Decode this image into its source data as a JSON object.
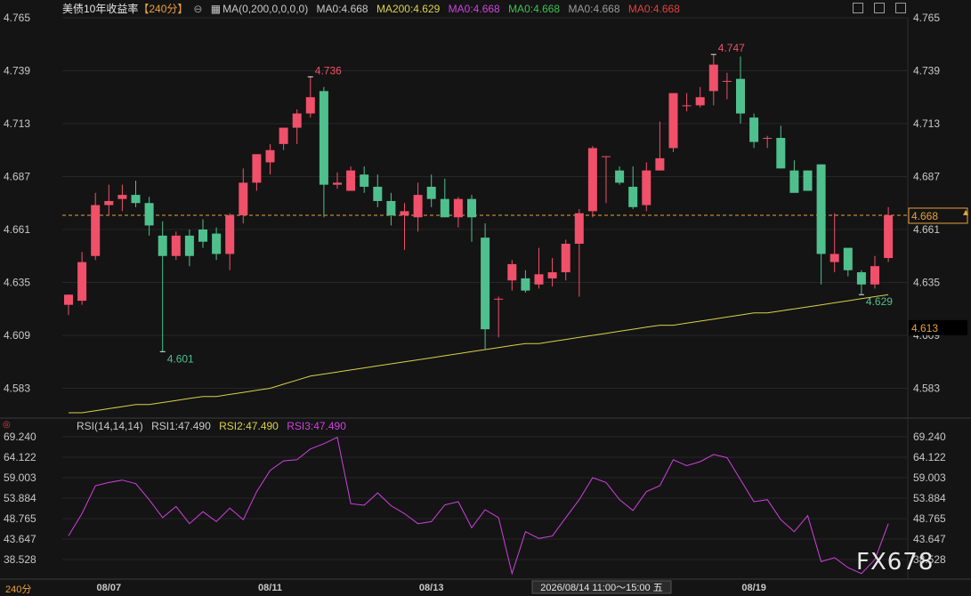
{
  "header": {
    "symbol": "美债10年收益率",
    "period": "【240分】",
    "indicator_name": "MA(0,200,0,0,0,0)",
    "ma0_a": "MA0:4.668",
    "ma200": "MA200:4.629",
    "ma0_b": "MA0:4.668",
    "ma0_c": "MA0:4.668",
    "ma0_d": "MA0:4.668",
    "ma0_e": "MA0:4.668"
  },
  "rsi_header": {
    "name": "RSI(14,14,14)",
    "rsi1": "RSI1:47.490",
    "rsi2": "RSI2:47.490",
    "rsi3": "RSI3:47.490"
  },
  "timeframe_label": "240分",
  "crosshair_time": "2026/08/14 11:00～15:00 五",
  "watermark": "FX678",
  "colors": {
    "up": "#f0506a",
    "down": "#4fc08d",
    "ma200": "#d9d14a",
    "rsi": "#d040e0",
    "last_line": "#e8a040",
    "bg": "#141414"
  },
  "chart_data": [
    {
      "type": "candlestick",
      "title": "美债10年收益率",
      "ylim": [
        4.57,
        4.765
      ],
      "y_ticks": [
        "4.765",
        "4.739",
        "4.713",
        "4.687",
        "4.661",
        "4.635",
        "4.609",
        "4.583"
      ],
      "x_labels": [
        {
          "index": 3,
          "label": "08/07"
        },
        {
          "index": 15,
          "label": "08/11"
        },
        {
          "index": 27,
          "label": "08/13"
        },
        {
          "index": 51,
          "label": "08/19"
        }
      ],
      "candles": [
        {
          "o": 4.624,
          "h": 4.629,
          "l": 4.619,
          "c": 4.629
        },
        {
          "o": 4.626,
          "h": 4.65,
          "l": 4.624,
          "c": 4.645
        },
        {
          "o": 4.648,
          "h": 4.679,
          "l": 4.646,
          "c": 4.673
        },
        {
          "o": 4.673,
          "h": 4.683,
          "l": 4.668,
          "c": 4.675
        },
        {
          "o": 4.676,
          "h": 4.683,
          "l": 4.67,
          "c": 4.678
        },
        {
          "o": 4.678,
          "h": 4.685,
          "l": 4.672,
          "c": 4.674
        },
        {
          "o": 4.674,
          "h": 4.677,
          "l": 4.658,
          "c": 4.663
        },
        {
          "o": 4.658,
          "h": 4.665,
          "l": 4.601,
          "c": 4.648
        },
        {
          "o": 4.648,
          "h": 4.66,
          "l": 4.646,
          "c": 4.658
        },
        {
          "o": 4.658,
          "h": 4.661,
          "l": 4.643,
          "c": 4.648
        },
        {
          "o": 4.661,
          "h": 4.666,
          "l": 4.652,
          "c": 4.655
        },
        {
          "o": 4.659,
          "h": 4.662,
          "l": 4.646,
          "c": 4.649
        },
        {
          "o": 4.649,
          "h": 4.669,
          "l": 4.641,
          "c": 4.668
        },
        {
          "o": 4.668,
          "h": 4.691,
          "l": 4.664,
          "c": 4.684
        },
        {
          "o": 4.684,
          "h": 4.698,
          "l": 4.68,
          "c": 4.698
        },
        {
          "o": 4.694,
          "h": 4.703,
          "l": 4.688,
          "c": 4.7
        },
        {
          "o": 4.703,
          "h": 4.711,
          "l": 4.7,
          "c": 4.711
        },
        {
          "o": 4.711,
          "h": 4.72,
          "l": 4.703,
          "c": 4.718
        },
        {
          "o": 4.718,
          "h": 4.736,
          "l": 4.716,
          "c": 4.726
        },
        {
          "o": 4.729,
          "h": 4.731,
          "l": 4.667,
          "c": 4.683
        },
        {
          "o": 4.683,
          "h": 4.689,
          "l": 4.681,
          "c": 4.684
        },
        {
          "o": 4.68,
          "h": 4.692,
          "l": 4.68,
          "c": 4.69
        },
        {
          "o": 4.688,
          "h": 4.692,
          "l": 4.679,
          "c": 4.682
        },
        {
          "o": 4.682,
          "h": 4.688,
          "l": 4.672,
          "c": 4.675
        },
        {
          "o": 4.675,
          "h": 4.679,
          "l": 4.663,
          "c": 4.668
        },
        {
          "o": 4.668,
          "h": 4.674,
          "l": 4.651,
          "c": 4.67
        },
        {
          "o": 4.667,
          "h": 4.684,
          "l": 4.66,
          "c": 4.678
        },
        {
          "o": 4.682,
          "h": 4.688,
          "l": 4.672,
          "c": 4.676
        },
        {
          "o": 4.676,
          "h": 4.686,
          "l": 4.667,
          "c": 4.667
        },
        {
          "o": 4.667,
          "h": 4.677,
          "l": 4.662,
          "c": 4.676
        },
        {
          "o": 4.676,
          "h": 4.678,
          "l": 4.655,
          "c": 4.667
        },
        {
          "o": 4.657,
          "h": 4.664,
          "l": 4.602,
          "c": 4.612
        },
        {
          "o": 4.627,
          "h": 4.628,
          "l": 4.608,
          "c": 4.627
        },
        {
          "o": 4.636,
          "h": 4.646,
          "l": 4.631,
          "c": 4.644
        },
        {
          "o": 4.637,
          "h": 4.641,
          "l": 4.63,
          "c": 4.631
        },
        {
          "o": 4.634,
          "h": 4.652,
          "l": 4.632,
          "c": 4.639
        },
        {
          "o": 4.637,
          "h": 4.647,
          "l": 4.633,
          "c": 4.64
        },
        {
          "o": 4.64,
          "h": 4.656,
          "l": 4.636,
          "c": 4.654
        },
        {
          "o": 4.654,
          "h": 4.671,
          "l": 4.628,
          "c": 4.669
        },
        {
          "o": 4.67,
          "h": 4.702,
          "l": 4.667,
          "c": 4.701
        },
        {
          "o": 4.697,
          "h": 4.697,
          "l": 4.674,
          "c": 4.697
        },
        {
          "o": 4.69,
          "h": 4.692,
          "l": 4.683,
          "c": 4.684
        },
        {
          "o": 4.682,
          "h": 4.692,
          "l": 4.671,
          "c": 4.672
        },
        {
          "o": 4.673,
          "h": 4.694,
          "l": 4.67,
          "c": 4.69
        },
        {
          "o": 4.69,
          "h": 4.714,
          "l": 4.69,
          "c": 4.696
        },
        {
          "o": 4.701,
          "h": 4.727,
          "l": 4.699,
          "c": 4.728
        },
        {
          "o": 4.722,
          "h": 4.728,
          "l": 4.719,
          "c": 4.722
        },
        {
          "o": 4.722,
          "h": 4.731,
          "l": 4.721,
          "c": 4.726
        },
        {
          "o": 4.729,
          "h": 4.747,
          "l": 4.722,
          "c": 4.742
        },
        {
          "o": 4.734,
          "h": 4.738,
          "l": 4.725,
          "c": 4.734
        },
        {
          "o": 4.735,
          "h": 4.746,
          "l": 4.713,
          "c": 4.718
        },
        {
          "o": 4.716,
          "h": 4.718,
          "l": 4.701,
          "c": 4.704
        },
        {
          "o": 4.706,
          "h": 4.707,
          "l": 4.701,
          "c": 4.706
        },
        {
          "o": 4.706,
          "h": 4.712,
          "l": 4.691,
          "c": 4.691
        },
        {
          "o": 4.69,
          "h": 4.695,
          "l": 4.68,
          "c": 4.679
        },
        {
          "o": 4.69,
          "h": 4.69,
          "l": 4.68,
          "c": 4.68
        },
        {
          "o": 4.693,
          "h": 4.693,
          "l": 4.634,
          "c": 4.649
        },
        {
          "o": 4.645,
          "h": 4.669,
          "l": 4.64,
          "c": 4.649
        },
        {
          "o": 4.652,
          "h": 4.652,
          "l": 4.638,
          "c": 4.641
        },
        {
          "o": 4.64,
          "h": 4.641,
          "l": 4.629,
          "c": 4.634
        },
        {
          "o": 4.634,
          "h": 4.648,
          "l": 4.632,
          "c": 4.643
        },
        {
          "o": 4.647,
          "h": 4.672,
          "l": 4.645,
          "c": 4.668
        }
      ],
      "ma200": [
        4.571,
        4.571,
        4.572,
        4.573,
        4.574,
        4.575,
        4.575,
        4.576,
        4.577,
        4.578,
        4.579,
        4.579,
        4.58,
        4.581,
        4.582,
        4.583,
        4.585,
        4.587,
        4.589,
        4.59,
        4.591,
        4.592,
        4.593,
        4.594,
        4.595,
        4.596,
        4.597,
        4.598,
        4.599,
        4.6,
        4.601,
        4.602,
        4.603,
        4.604,
        4.605,
        4.605,
        4.606,
        4.607,
        4.608,
        4.609,
        4.61,
        4.611,
        4.612,
        4.613,
        4.614,
        4.614,
        4.615,
        4.616,
        4.617,
        4.618,
        4.619,
        4.62,
        4.62,
        4.621,
        4.622,
        4.623,
        4.624,
        4.625,
        4.626,
        4.627,
        4.628,
        4.629
      ],
      "last_price": {
        "value": 4.668,
        "label": "4.668"
      },
      "ma200_last_label": "4.613",
      "annotations": [
        {
          "index": 7,
          "value": 4.601,
          "label": "4.601"
        },
        {
          "index": 18,
          "value": 4.736,
          "label": "4.736"
        },
        {
          "index": 48,
          "value": 4.747,
          "label": "4.747"
        },
        {
          "index": 59,
          "value": 4.629,
          "label": "4.629"
        }
      ]
    },
    {
      "type": "line",
      "title": "RSI(14,14,14)",
      "ylim": [
        34.4,
        69.24
      ],
      "y_ticks": [
        "69.240",
        "64.122",
        "59.003",
        "53.884",
        "48.765",
        "43.647",
        "38.528"
      ],
      "values": [
        44.5,
        50,
        57,
        57.8,
        58.4,
        57.5,
        53.5,
        49,
        51.8,
        47.5,
        50.5,
        48,
        51.4,
        48.5,
        55.5,
        60.8,
        63.2,
        63.5,
        66.2,
        67.5,
        69.1,
        52.5,
        52.1,
        55.2,
        52,
        50,
        47.5,
        48,
        52.2,
        53,
        46.5,
        51,
        49,
        35,
        45.5,
        43.8,
        44.4,
        49,
        53.5,
        59,
        57.8,
        53.5,
        50.8,
        55.5,
        57,
        63.5,
        62,
        63,
        64.8,
        64,
        58.5,
        53,
        53.5,
        48.5,
        45.5,
        49.5,
        38,
        39,
        36.5,
        35,
        38.5,
        47.5
      ]
    }
  ]
}
